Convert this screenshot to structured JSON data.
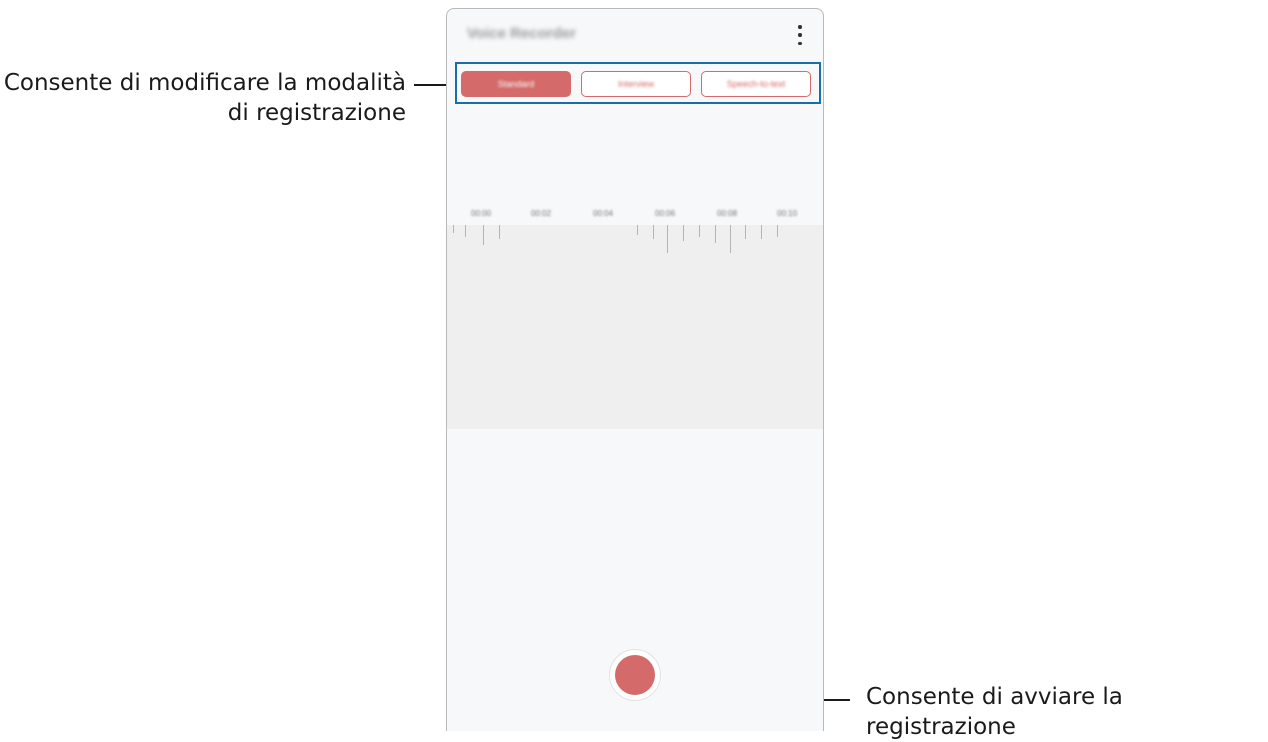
{
  "annotations": {
    "mode_line1": "Consente di modificare la modalità",
    "mode_line2": "di registrazione",
    "record": "Consente di avviare la registrazione"
  },
  "app": {
    "title": "Voice Recorder",
    "menu_icon": "more-vertical-icon"
  },
  "mode_tabs": [
    {
      "label": "Standard",
      "active": true
    },
    {
      "label": "Interview",
      "active": false
    },
    {
      "label": "Speech-to-text",
      "active": false
    }
  ],
  "timeline": [
    "00:00",
    "00:02",
    "00:04",
    "00:06",
    "00:08",
    "00:10"
  ],
  "colors": {
    "accent": "#d46a6a",
    "highlight": "#1a6ea8",
    "background": "#f6f8f9",
    "waveform_area": "#efefef"
  }
}
